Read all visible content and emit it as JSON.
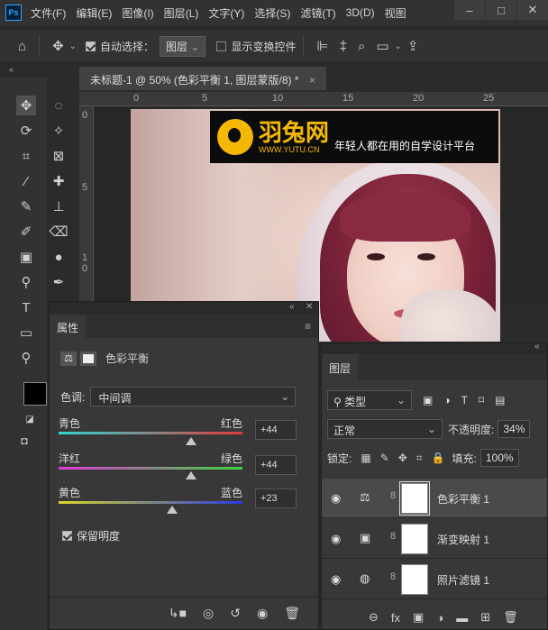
{
  "app": {
    "logo": "Ps"
  },
  "menu": [
    "文件(F)",
    "编辑(E)",
    "图像(I)",
    "图层(L)",
    "文字(Y)",
    "选择(S)",
    "滤镜(T)",
    "3D(D)",
    "视图"
  ],
  "window_controls": {
    "minimize": "–",
    "maximize": "□",
    "close": "✕"
  },
  "options_bar": {
    "auto_select_label": "自动选择：",
    "auto_select_target": "图层",
    "show_transform_label": "显示变换控件"
  },
  "toolbar": {
    "collapse": "«"
  },
  "document": {
    "tab_title": "未标题-1 @ 50% (色彩平衡 1, 图层蒙版/8) *",
    "close": "×"
  },
  "ruler": {
    "h_ticks": [
      "0",
      "5",
      "10",
      "15",
      "20",
      "25"
    ],
    "v_ticks": [
      "0",
      "5",
      "1",
      "0"
    ]
  },
  "watermark": {
    "brand": "羽兔网",
    "url": "WWW.YUTU.CN",
    "slogan": "年轻人都在用的自学设计平台"
  },
  "properties": {
    "tab": "属性",
    "adjustment_name": "色彩平衡",
    "tone_label": "色调:",
    "tone_value": "中间调",
    "sliders": [
      {
        "left": "青色",
        "right": "红色",
        "value": "+44",
        "position": 0.72,
        "left_color": "#2fd5d5",
        "right_color": "#e23a3a"
      },
      {
        "left": "洋红",
        "right": "绿色",
        "value": "+44",
        "position": 0.72,
        "left_color": "#e03ad8",
        "right_color": "#3ad63a"
      },
      {
        "left": "黄色",
        "right": "蓝色",
        "value": "+23",
        "position": 0.62,
        "left_color": "#d8d82a",
        "right_color": "#2a3ae0"
      }
    ],
    "preserve_label": "保留明度"
  },
  "layers": {
    "tab": "图层",
    "kind_filter": "类型",
    "blend_mode": "正常",
    "opacity_label": "不透明度:",
    "opacity_value": "34%",
    "lock_label": "锁定:",
    "fill_label": "填充:",
    "fill_value": "100%",
    "items": [
      {
        "name": "色彩平衡 1",
        "selected": true
      },
      {
        "name": "渐变映射 1",
        "selected": false
      },
      {
        "name": "照片滤镜 1",
        "selected": false
      }
    ]
  },
  "colors": {
    "accent": "#f5b800",
    "panel_bg": "#383838",
    "app_bg": "#2b2b2b"
  }
}
